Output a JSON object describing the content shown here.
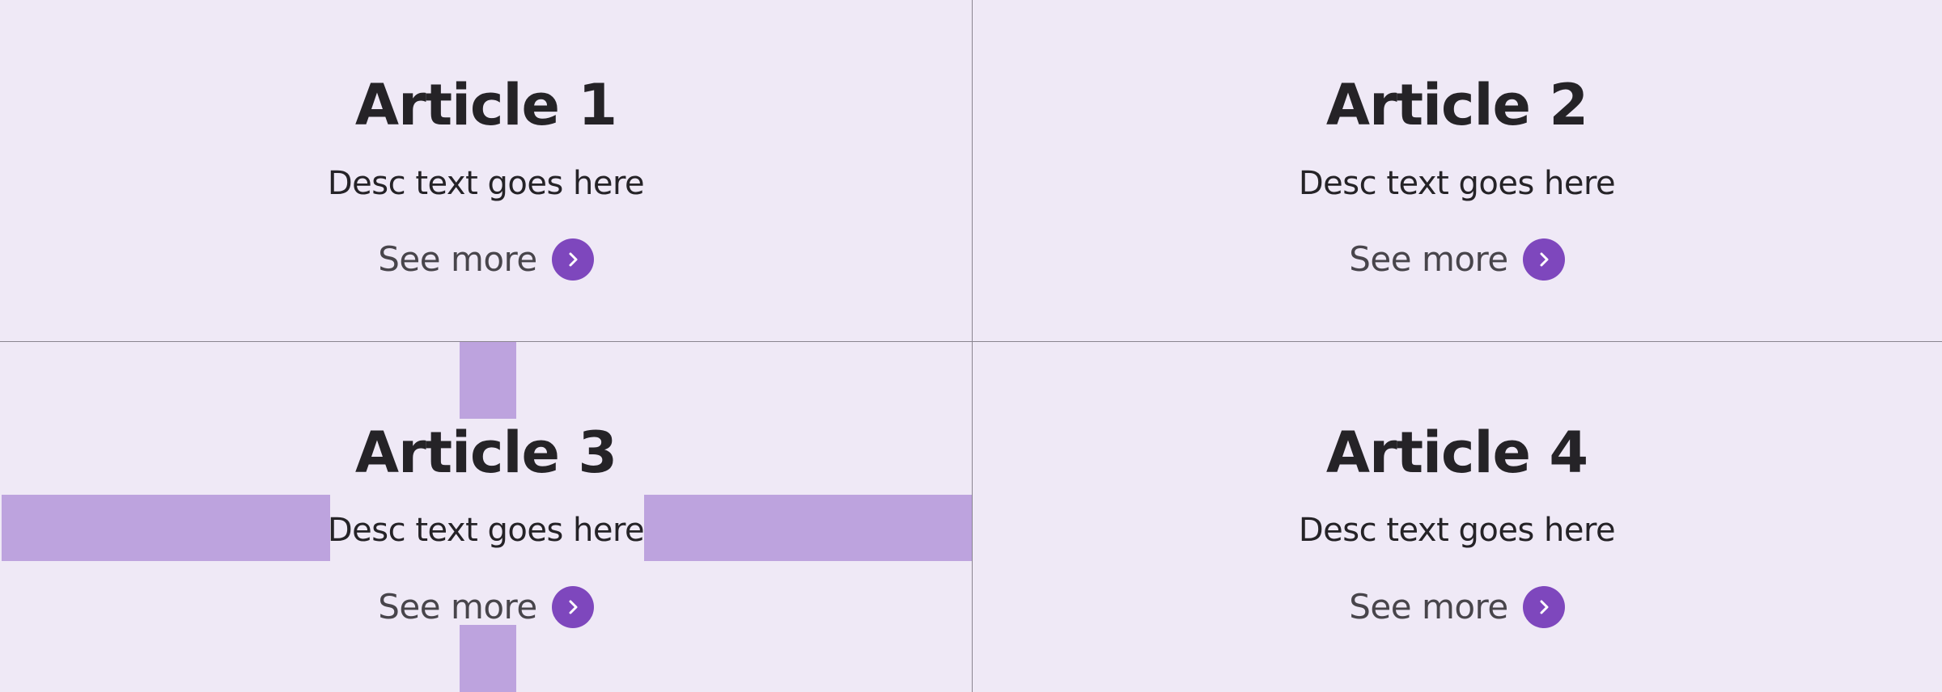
{
  "colors": {
    "background": "#efe9f6",
    "divider": "#8a8590",
    "accent": "#7e47bd",
    "spacing_overlay": "#bda3de",
    "title_text": "#252327"
  },
  "articles": [
    {
      "title": "Article 1",
      "desc": "Desc text goes here",
      "more_label": "See more",
      "icon": "chevron-right-icon"
    },
    {
      "title": "Article 2",
      "desc": "Desc text goes here",
      "more_label": "See more",
      "icon": "chevron-right-icon"
    },
    {
      "title": "Article 3",
      "desc": "Desc text goes here",
      "more_label": "See more",
      "icon": "chevron-right-icon"
    },
    {
      "title": "Article 4",
      "desc": "Desc text goes here",
      "more_label": "See more",
      "icon": "chevron-right-icon"
    }
  ]
}
